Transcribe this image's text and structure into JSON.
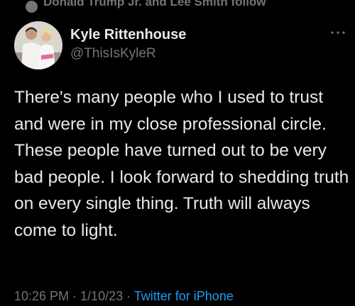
{
  "social_context": {
    "text": "Donald Trump Jr. and Lee Smith follow"
  },
  "author": {
    "name": "Kyle Rittenhouse",
    "handle": "@ThisIsKyleR",
    "avatar_icon": "profile-photo"
  },
  "tweet": {
    "text": "There's many people who I used to trust and were in my close professional circle. These people have turned out to be very bad people. I look forward to shedding truth on every single thing. Truth will always come to light.",
    "time": "10:26 PM",
    "separator": " · ",
    "date": "1/10/23",
    "source": "Twitter for iPhone"
  },
  "colors": {
    "background": "#000000",
    "text": "#e7e9ea",
    "secondary": "#71767b",
    "link": "#1d9bf0"
  }
}
